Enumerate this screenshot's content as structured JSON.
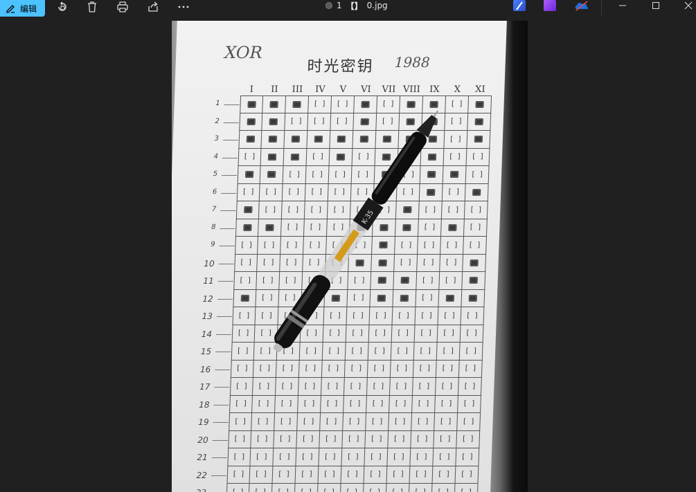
{
  "toolbar": {
    "edit_label": "编辑",
    "accent_color": "#4cc2ff",
    "icons": [
      "edit-icon",
      "rotate-icon",
      "delete-icon",
      "print-icon",
      "share-icon",
      "more-icon"
    ]
  },
  "title": {
    "counter": "1",
    "filename": "0.jpg"
  },
  "photo": {
    "handwritten_note": "XOR",
    "sheet_title": "时光密钥",
    "handwritten_year": "1988",
    "columns": [
      "I",
      "II",
      "III",
      "IV",
      "V",
      "VI",
      "VII",
      "VIII",
      "IX",
      "X",
      "XI"
    ],
    "rows": [
      "1",
      "2",
      "3",
      "4",
      "5",
      "6",
      "7",
      "8",
      "9",
      "10",
      "11",
      "12",
      "13",
      "14",
      "15",
      "16",
      "17",
      "18",
      "19",
      "20",
      "21",
      "22",
      "23"
    ],
    "empty_cell": "[ ]",
    "filled": {
      "1": [
        1,
        2,
        3,
        6,
        8,
        9,
        11
      ],
      "2": [
        1,
        2,
        6,
        8,
        9,
        11
      ],
      "3": [
        1,
        2,
        3,
        4,
        5,
        6,
        7,
        8,
        9,
        11
      ],
      "4": [
        2,
        3,
        5,
        7,
        9
      ],
      "5": [
        1,
        2,
        7,
        9,
        10
      ],
      "6": [
        7,
        9,
        11
      ],
      "7": [
        1,
        8
      ],
      "8": [
        1,
        2,
        6,
        7,
        8,
        10
      ],
      "9": [
        7
      ],
      "10": [
        6,
        7,
        11
      ],
      "11": [
        7,
        8,
        11
      ],
      "12": [
        1,
        5,
        7,
        8,
        10,
        11
      ]
    }
  }
}
